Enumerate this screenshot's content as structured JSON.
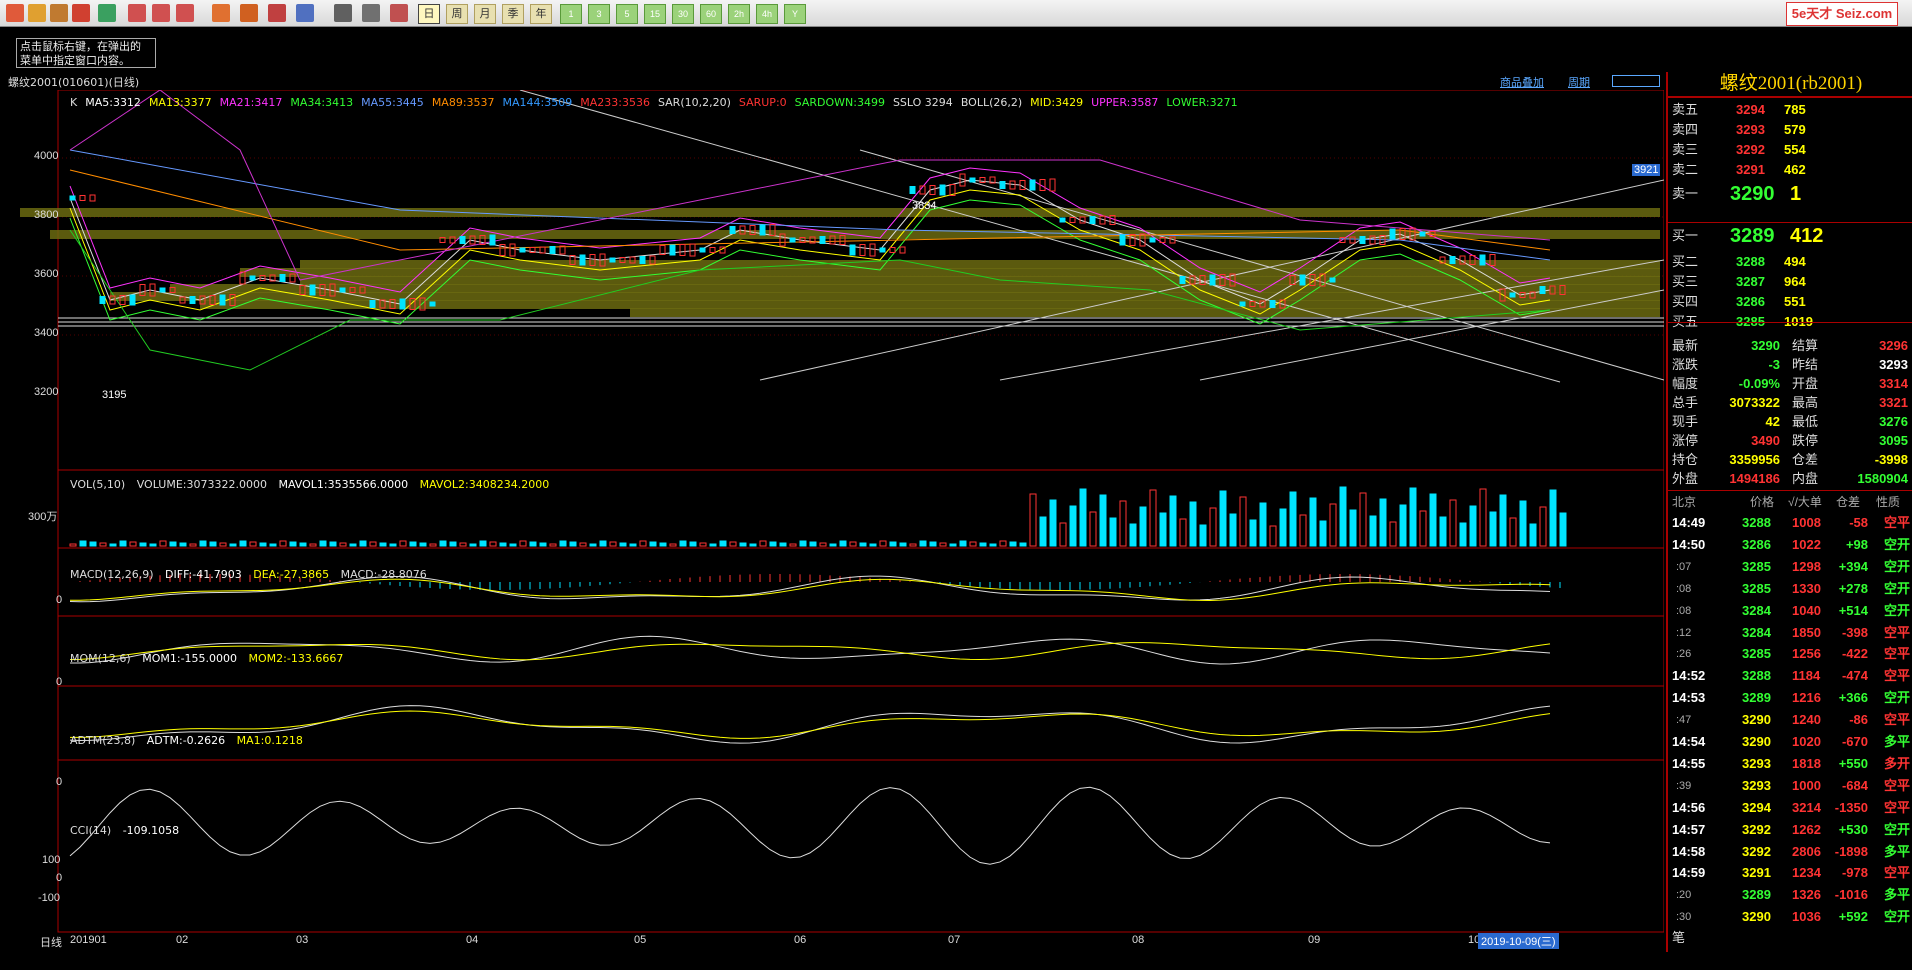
{
  "toolbar": {
    "period_labels": [
      "日",
      "周",
      "月",
      "季",
      "年"
    ],
    "num_labels": [
      "1",
      "3",
      "5",
      "15",
      "30",
      "60",
      "2h",
      "4h",
      "Y"
    ],
    "logo": "5e天才 Seiz.com"
  },
  "tip": {
    "line1": "点击鼠标右键，在弹出的",
    "line2": "菜单中指定窗口内容。"
  },
  "chart": {
    "name": "螺纹2001(010601)(日线)",
    "link_overlay": "商品叠加",
    "link_period": "周期",
    "price_labels": [
      "4000",
      "3800",
      "3600",
      "3400",
      "3200"
    ],
    "high_marker": "3834",
    "low_marker": "3195",
    "right_price_tag": "3921",
    "x_labels": [
      "日线",
      "201901",
      "02",
      "03",
      "04",
      "05",
      "06",
      "07",
      "08",
      "09",
      "10"
    ],
    "date_tag": "2019-10-09(三)",
    "main_indicators": [
      {
        "text": "K",
        "color": "#dddddd"
      },
      {
        "text": "MA5:3312",
        "color": "#ffffff"
      },
      {
        "text": "MA13:3377",
        "color": "#ffff00"
      },
      {
        "text": "MA21:3417",
        "color": "#ff33ff"
      },
      {
        "text": "MA34:3413",
        "color": "#33ff33"
      },
      {
        "text": "MA55:3445",
        "color": "#6699ff"
      },
      {
        "text": "MA89:3537",
        "color": "#ff8c00"
      },
      {
        "text": "MA144:3509",
        "color": "#3399ff"
      },
      {
        "text": "MA233:3536",
        "color": "#ff3333"
      },
      {
        "text": "SAR(10,2,20)",
        "color": "#dddddd"
      },
      {
        "text": "SARUP:0",
        "color": "#ff3333"
      },
      {
        "text": "SARDOWN:3499",
        "color": "#33ff33"
      },
      {
        "text": "SSLO 3294",
        "color": "#dddddd"
      },
      {
        "text": "BOLL(26,2)",
        "color": "#dddddd"
      },
      {
        "text": "MID:3429",
        "color": "#ffff00"
      },
      {
        "text": "UPPER:3587",
        "color": "#ff33ff"
      },
      {
        "text": "LOWER:3271",
        "color": "#33ff33"
      }
    ],
    "vol": {
      "label": "VOL(5,10)",
      "volume": "VOLUME:3073322.0000",
      "mavol1": "MAVOL1:3535566.0000",
      "mavol2": "MAVOL2:3408234.2000",
      "axis": "300万"
    },
    "macd": {
      "label": "MACD(12,26,9)",
      "diff": "DIFF:-41.7903",
      "dea": "DEA:-27.3865",
      "macd": "MACD:-28.8076",
      "axis": "0"
    },
    "mom": {
      "label": "MOM(12,6)",
      "mom1": "MOM1:-155.0000",
      "mom2": "MOM2:-133.6667",
      "axis": "0"
    },
    "adtm": {
      "label": "ADTM(23,8)",
      "adtm": "ADTM:-0.2626",
      "ma1": "MA1:0.1218",
      "axis": "0"
    },
    "cci": {
      "label": "CCI(14)",
      "value": "-109.1058",
      "axis": [
        "100",
        "0",
        "-100"
      ]
    }
  },
  "quote": {
    "title": "螺纹2001(rb2001)",
    "asks": [
      {
        "label": "卖五",
        "price": "3294",
        "vol": "785"
      },
      {
        "label": "卖四",
        "price": "3293",
        "vol": "579"
      },
      {
        "label": "卖三",
        "price": "3292",
        "vol": "554"
      },
      {
        "label": "卖二",
        "price": "3291",
        "vol": "462"
      },
      {
        "label": "卖一",
        "price": "3290",
        "vol": "1"
      }
    ],
    "bids": [
      {
        "label": "买一",
        "price": "3289",
        "vol": "412"
      },
      {
        "label": "买二",
        "price": "3288",
        "vol": "494"
      },
      {
        "label": "买三",
        "price": "3287",
        "vol": "964"
      },
      {
        "label": "买四",
        "price": "3286",
        "vol": "551"
      },
      {
        "label": "买五",
        "price": "3285",
        "vol": "1019"
      }
    ],
    "stats": [
      {
        "l1": "最新",
        "v1": "3290",
        "c1": "#33ff33",
        "l2": "结算",
        "v2": "3296",
        "c2": "#ff3333"
      },
      {
        "l1": "涨跌",
        "v1": "-3",
        "c1": "#33ff33",
        "l2": "昨结",
        "v2": "3293",
        "c2": "#ffffff"
      },
      {
        "l1": "幅度",
        "v1": "-0.09%",
        "c1": "#33ff33",
        "l2": "开盘",
        "v2": "3314",
        "c2": "#ff3333"
      },
      {
        "l1": "总手",
        "v1": "3073322",
        "c1": "#ffff00",
        "l2": "最高",
        "v2": "3321",
        "c2": "#ff3333"
      },
      {
        "l1": "现手",
        "v1": "42",
        "c1": "#ffff00",
        "l2": "最低",
        "v2": "3276",
        "c2": "#33ff33"
      },
      {
        "l1": "涨停",
        "v1": "3490",
        "c1": "#ff3333",
        "l2": "跌停",
        "v2": "3095",
        "c2": "#33ff33"
      },
      {
        "l1": "持仓",
        "v1": "3359956",
        "c1": "#ffff00",
        "l2": "仓差",
        "v2": "-3998",
        "c2": "#ffff00"
      },
      {
        "l1": "外盘",
        "v1": "1494186",
        "c1": "#ff3333",
        "l2": "内盘",
        "v2": "1580904",
        "c2": "#33ff33"
      }
    ],
    "tick_header": {
      "time": "北京",
      "price": "价格",
      "vol": "√/大单",
      "oi": "仓差",
      "nature": "性质"
    },
    "ticks": [
      {
        "t": "14:49",
        "p": "3288",
        "v": "1008",
        "d": "-58",
        "n": "空平",
        "nc": "#ff3333"
      },
      {
        "t": "14:50",
        "p": "3286",
        "v": "1022",
        "d": "+98",
        "n": "空开",
        "nc": "#33ff33"
      },
      {
        "t": ":07",
        "p": "3285",
        "v": "1298",
        "d": "+394",
        "n": "空开",
        "nc": "#33ff33"
      },
      {
        "t": ":08",
        "p": "3285",
        "v": "1330",
        "d": "+278",
        "n": "空开",
        "nc": "#33ff33"
      },
      {
        "t": ":08",
        "p": "3284",
        "v": "1040",
        "d": "+514",
        "n": "空开",
        "nc": "#33ff33"
      },
      {
        "t": ":12",
        "p": "3284",
        "v": "1850",
        "d": "-398",
        "n": "空平",
        "nc": "#ff3333"
      },
      {
        "t": ":26",
        "p": "3285",
        "v": "1256",
        "d": "-422",
        "n": "空平",
        "nc": "#ff3333"
      },
      {
        "t": "14:52",
        "p": "3288",
        "v": "1184",
        "d": "-474",
        "n": "空平",
        "nc": "#ff3333"
      },
      {
        "t": "14:53",
        "p": "3289",
        "v": "1216",
        "d": "+366",
        "n": "空开",
        "nc": "#33ff33"
      },
      {
        "t": ":47",
        "p": "3290",
        "v": "1240",
        "d": "-86",
        "n": "空平",
        "nc": "#ff3333"
      },
      {
        "t": "14:54",
        "p": "3290",
        "v": "1020",
        "d": "-670",
        "n": "多平",
        "nc": "#33ff33"
      },
      {
        "t": "14:55",
        "p": "3293",
        "v": "1818",
        "d": "+550",
        "n": "多开",
        "nc": "#ff3333"
      },
      {
        "t": ":39",
        "p": "3293",
        "v": "1000",
        "d": "-684",
        "n": "空平",
        "nc": "#ff3333"
      },
      {
        "t": "14:56",
        "p": "3294",
        "v": "3214",
        "d": "-1350",
        "n": "空平",
        "nc": "#ff3333"
      },
      {
        "t": "14:57",
        "p": "3292",
        "v": "1262",
        "d": "+530",
        "n": "空开",
        "nc": "#33ff33"
      },
      {
        "t": "14:58",
        "p": "3292",
        "v": "2806",
        "d": "-1898",
        "n": "多平",
        "nc": "#33ff33"
      },
      {
        "t": "14:59",
        "p": "3291",
        "v": "1234",
        "d": "-978",
        "n": "空平",
        "nc": "#ff3333"
      },
      {
        "t": ":20",
        "p": "3289",
        "v": "1326",
        "d": "-1016",
        "n": "多平",
        "nc": "#33ff33"
      },
      {
        "t": ":30",
        "p": "3290",
        "v": "1036",
        "d": "+592",
        "n": "空开",
        "nc": "#33ff33"
      }
    ],
    "footer": "笔"
  }
}
